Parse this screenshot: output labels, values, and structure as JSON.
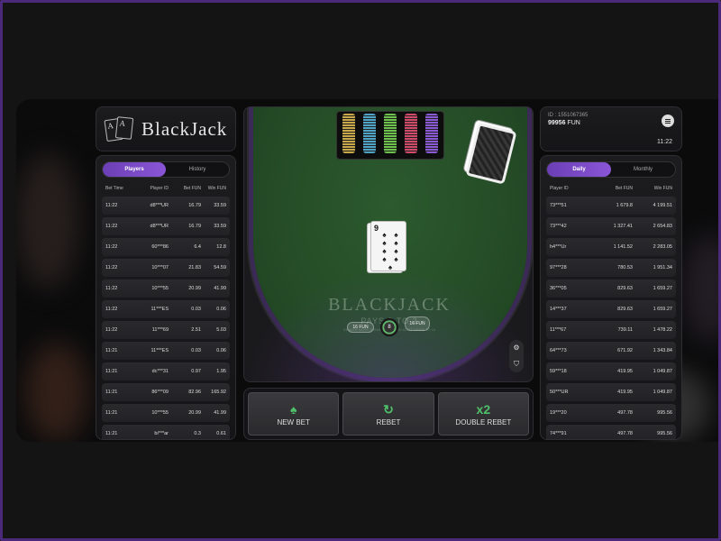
{
  "logo": {
    "text": "BlackJack",
    "card1": "A",
    "card2": "A"
  },
  "left": {
    "tabs": [
      "Players",
      "History"
    ],
    "active_tab": "Players",
    "headers": {
      "time": "Bet Time",
      "player": "Player ID",
      "bet": "Bet  FUN",
      "win": "Win  FUN"
    },
    "rows": [
      {
        "time": "11:22",
        "player": "d8***UR",
        "bet": "16.79",
        "win": "33.59"
      },
      {
        "time": "11:22",
        "player": "d8***UR",
        "bet": "16.79",
        "win": "33.59"
      },
      {
        "time": "11:22",
        "player": "60***86",
        "bet": "6.4",
        "win": "12.8"
      },
      {
        "time": "11:22",
        "player": "10***07",
        "bet": "21.83",
        "win": "54.59"
      },
      {
        "time": "11:22",
        "player": "10***55",
        "bet": "20.99",
        "win": "41.99"
      },
      {
        "time": "11:22",
        "player": "11***ES",
        "bet": "0.03",
        "win": "0.06"
      },
      {
        "time": "11:22",
        "player": "11***69",
        "bet": "2.51",
        "win": "5.03"
      },
      {
        "time": "11:21",
        "player": "11***ES",
        "bet": "0.03",
        "win": "0.06"
      },
      {
        "time": "11:21",
        "player": "dc***31",
        "bet": "0.97",
        "win": "1.95"
      },
      {
        "time": "11:21",
        "player": "86***09",
        "bet": "82.96",
        "win": "165.92"
      },
      {
        "time": "11:21",
        "player": "10***55",
        "bet": "20.99",
        "win": "41.99"
      },
      {
        "time": "11:21",
        "player": "bi***ar",
        "bet": "0.3",
        "win": "0.61"
      }
    ]
  },
  "table": {
    "title": "BLACKJACK",
    "subtitle": "PAYS 3 TO 2",
    "rule": "DEALER MUST STAND ON 17 AND MUST DRAW TO 16",
    "card_rank": "9",
    "card_suit": "♠",
    "left_bet": "16 FUN",
    "right_bet": "16 FUN",
    "chip_value": "8",
    "chip_colors": [
      "#c9a84a",
      "#4fa3c7",
      "#6cc24a",
      "#d04a6a",
      "#8a5ad6"
    ]
  },
  "actions": {
    "new_bet": "NEW BET",
    "rebet": "REBET",
    "double_rebet": "DOUBLE REBET",
    "double_icon": "x2"
  },
  "info": {
    "id": "ID : 1551067365",
    "balance": "99956",
    "currency": "FUN",
    "time": "11:22"
  },
  "right": {
    "tabs": [
      "Daily",
      "Monthly"
    ],
    "active_tab": "Daily",
    "headers": {
      "player": "Player ID",
      "bet": "Bet  FUN",
      "win": "Win  FUN"
    },
    "rows": [
      {
        "player": "73***51",
        "bet": "1 679.8",
        "win": "4 199.51"
      },
      {
        "player": "73***42",
        "bet": "1 327.41",
        "win": "2 654.83"
      },
      {
        "player": "h4***Ur",
        "bet": "1 141.52",
        "win": "2 283.05"
      },
      {
        "player": "97***28",
        "bet": "780.53",
        "win": "1 951.34"
      },
      {
        "player": "36***05",
        "bet": "829.63",
        "win": "1 659.27"
      },
      {
        "player": "14***37",
        "bet": "829.63",
        "win": "1 659.27"
      },
      {
        "player": "11***67",
        "bet": "739.11",
        "win": "1 478.22"
      },
      {
        "player": "64***73",
        "bet": "671.92",
        "win": "1 343.84"
      },
      {
        "player": "59***18",
        "bet": "419.95",
        "win": "1 049.87"
      },
      {
        "player": "50***UR",
        "bet": "419.95",
        "win": "1 049.87"
      },
      {
        "player": "19***20",
        "bet": "497.78",
        "win": "995.56"
      },
      {
        "player": "74***91",
        "bet": "497.78",
        "win": "995.56"
      }
    ]
  }
}
